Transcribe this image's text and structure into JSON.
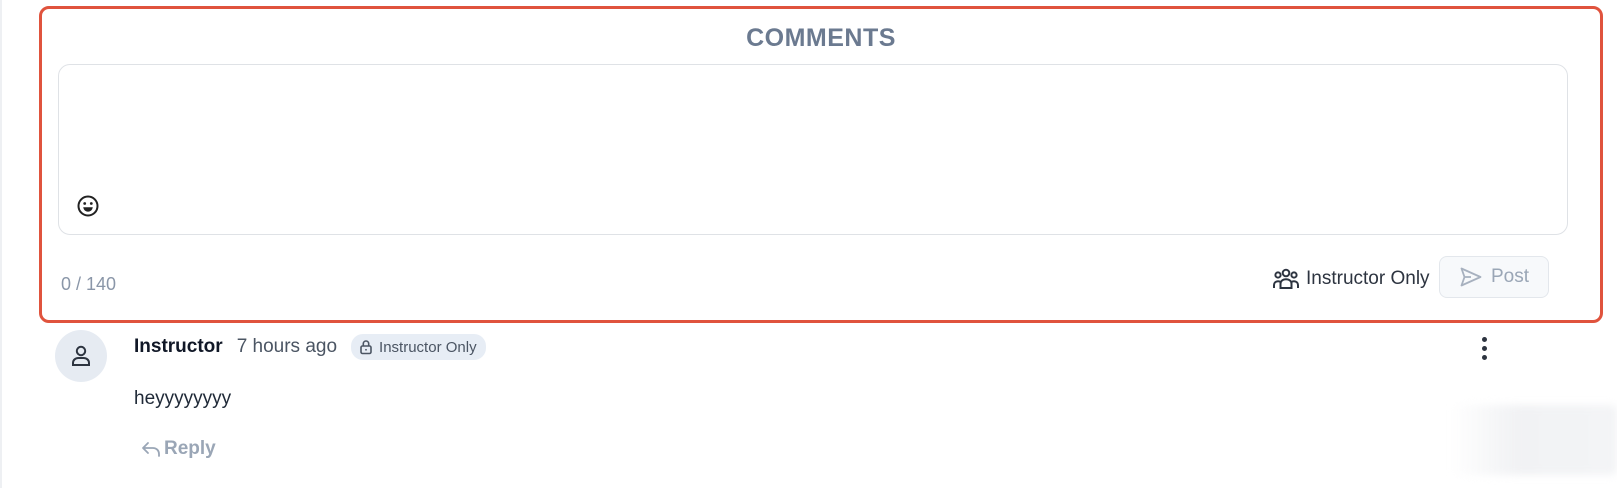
{
  "comments": {
    "title": "COMMENTS",
    "input_value": "",
    "char_count": "0 / 140",
    "visibility_label": "Instructor Only",
    "post_label": "Post"
  },
  "comment_list": [
    {
      "author": "Instructor",
      "time": "7 hours ago",
      "badge": "Instructor Only",
      "body": "heyyyyyyyy",
      "reply_label": "Reply"
    }
  ],
  "colors": {
    "highlight_border": "#e0533d",
    "title": "#6b7a90",
    "muted": "#9aa6b6"
  }
}
